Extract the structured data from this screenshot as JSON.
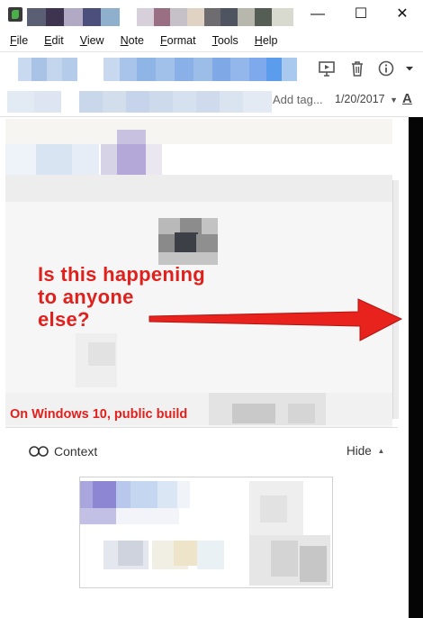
{
  "window": {
    "controls": {
      "minimize": "—",
      "maximize": "☐",
      "close": "✕"
    }
  },
  "menu": [
    {
      "label": "File"
    },
    {
      "label": "Edit"
    },
    {
      "label": "View"
    },
    {
      "label": "Note"
    },
    {
      "label": "Format"
    },
    {
      "label": "Tools"
    },
    {
      "label": "Help"
    }
  ],
  "toolbar": {
    "present_icon": "presentation-icon",
    "delete_icon": "trash-icon",
    "info_icon": "info-icon",
    "more_icon": "dropdown-icon"
  },
  "note_meta": {
    "add_tag_placeholder": "Add tag...",
    "date": "1/20/2017",
    "font_button": "A"
  },
  "annotation": {
    "line1": "Is this happening",
    "line2": "to anyone",
    "line3": "else?",
    "footnote": "On Windows 10, public build"
  },
  "context": {
    "label": "Context",
    "hide_label": "Hide"
  },
  "colors": {
    "annotation_red": "#e0201c",
    "right_edge": "#050505"
  }
}
